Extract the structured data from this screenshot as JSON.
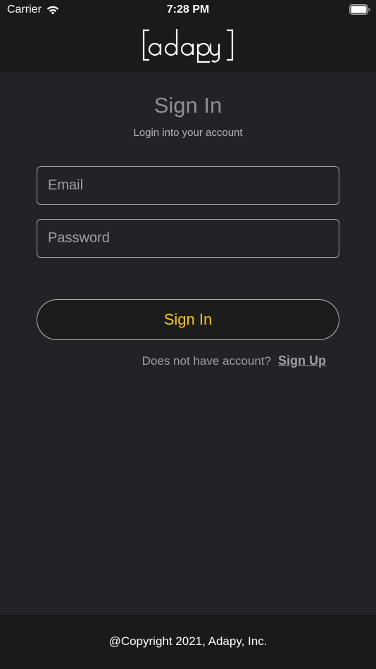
{
  "status_bar": {
    "carrier": "Carrier",
    "time": "7:28 PM",
    "wifi_icon": "wifi-icon",
    "battery_icon": "battery-icon"
  },
  "header": {
    "logo_text": "adapy"
  },
  "signin": {
    "title": "Sign In",
    "subtitle": "Login into your account",
    "email_placeholder": "Email",
    "email_value": "",
    "password_placeholder": "Password",
    "password_value": "",
    "button_label": "Sign In",
    "signup_prompt": "Does not have account?",
    "signup_link": "Sign Up"
  },
  "footer": {
    "copyright": "@Copyright 2021, Adapy, Inc."
  },
  "colors": {
    "background": "#222327",
    "bar_background": "#1a1a1a",
    "accent": "#f5c518",
    "muted_text": "#9ea0a4"
  }
}
